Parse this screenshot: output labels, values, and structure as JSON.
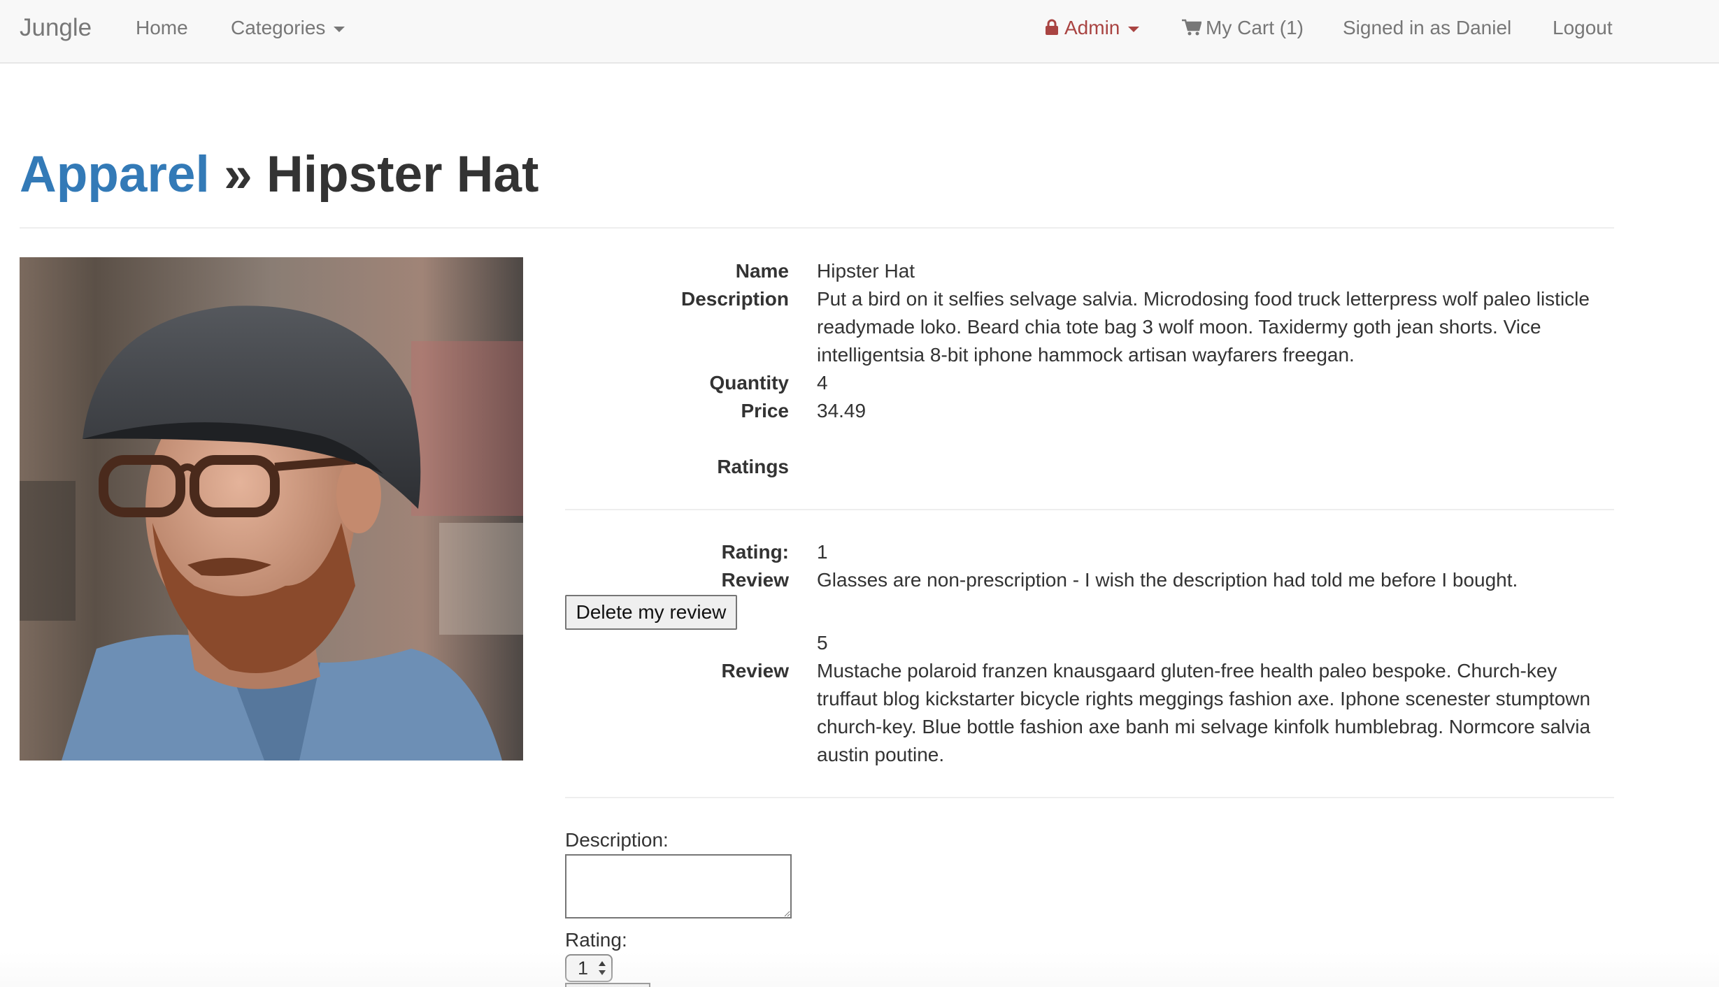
{
  "navbar": {
    "brand": "Jungle",
    "home": "Home",
    "categories": "Categories",
    "admin": "Admin",
    "cart": "My Cart (1)",
    "signed_in": "Signed in as Daniel",
    "logout": "Logout",
    "admin_color": "#a94442"
  },
  "header": {
    "category": "Apparel",
    "separator": "»",
    "product": "Hipster Hat",
    "link_color": "#337ab7"
  },
  "product": {
    "name_label": "Name",
    "name": "Hipster Hat",
    "description_label": "Description",
    "description": "Put a bird on it selfies selvage salvia. Microdosing food truck letterpress wolf paleo listicle readymade loko. Beard chia tote bag 3 wolf moon. Taxidermy goth jean shorts. Vice intelligentsia 8-bit iphone hammock artisan wayfarers freegan.",
    "quantity_label": "Quantity",
    "quantity": "4",
    "price_label": "Price",
    "price": "34.49",
    "ratings_label": "Ratings"
  },
  "reviews": [
    {
      "rating_label": "Rating:",
      "rating": "1",
      "review_label": "Review",
      "review": "Glasses are non-prescription - I wish the description had told me before I bought.",
      "delete_label": "Delete my review"
    },
    {
      "rating": "5",
      "review_label": "Review",
      "review": "Mustache polaroid franzen knausgaard gluten-free health paleo bespoke. Church-key truffaut blog kickstarter bicycle rights meggings fashion axe. Iphone scenester stumptown church-key. Blue bottle fashion axe banh mi selvage kinfolk humblebrag. Normcore salvia austin poutine."
    }
  ],
  "review_form": {
    "description_label": "Description:",
    "description_value": "",
    "rating_label": "Rating:",
    "rating_value": "1"
  }
}
